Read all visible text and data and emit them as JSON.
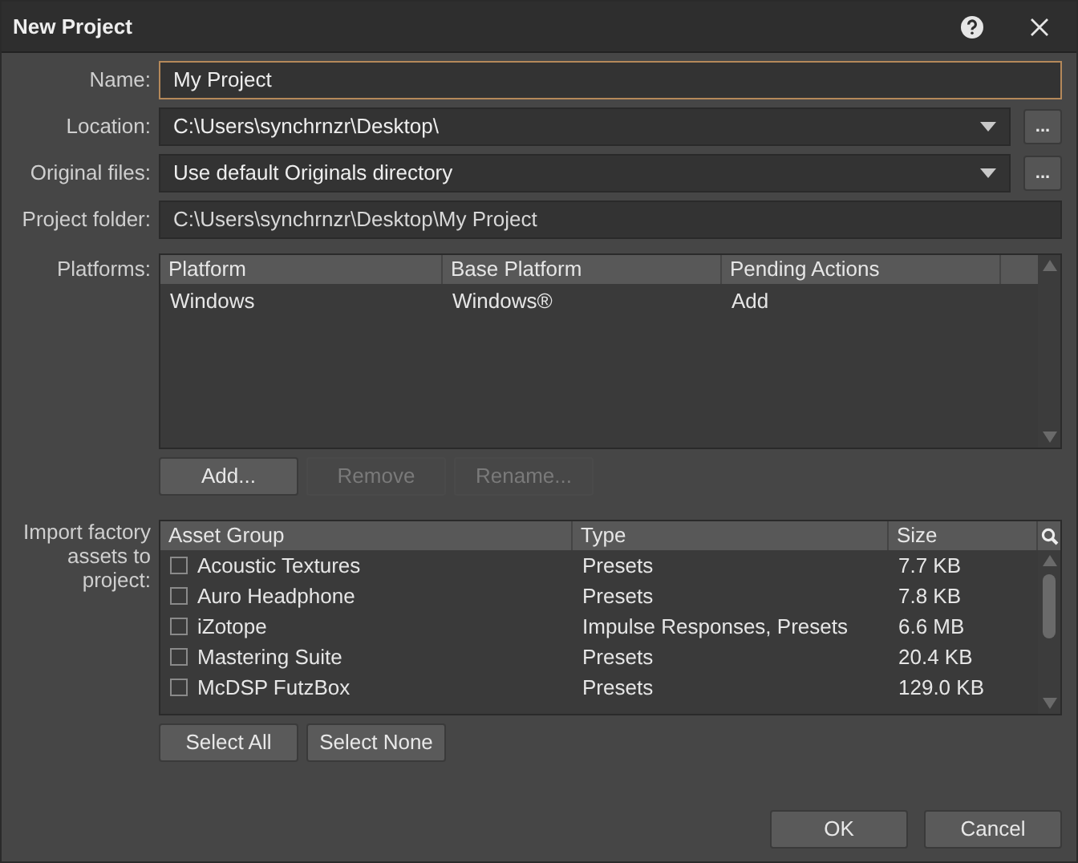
{
  "window": {
    "title": "New Project"
  },
  "fields": [
    {
      "label": "Name:",
      "kind": "text",
      "value": "My Project",
      "focused": true
    },
    {
      "label": "Location:",
      "kind": "combo",
      "value": "C:\\Users\\synchrnzr\\Desktop\\",
      "browse": "..."
    },
    {
      "label": "Original files:",
      "kind": "combo",
      "value": "Use default Originals directory",
      "browse": "..."
    },
    {
      "label": "Project folder:",
      "kind": "readonly",
      "value": "C:\\Users\\synchrnzr\\Desktop\\My Project"
    }
  ],
  "platforms": {
    "label": "Platforms:",
    "columns": [
      "Platform",
      "Base Platform",
      "Pending Actions"
    ],
    "rows": [
      {
        "cells": [
          "Windows",
          "Windows®",
          "Add"
        ]
      }
    ],
    "buttons": [
      {
        "label": "Add...",
        "disabled": false
      },
      {
        "label": "Remove",
        "disabled": true
      },
      {
        "label": "Rename...",
        "disabled": true
      }
    ]
  },
  "assets": {
    "label": "Import factory assets to project:",
    "columns": [
      "Asset Group",
      "Type",
      "Size"
    ],
    "rows": [
      {
        "name": "Acoustic Textures",
        "type": "Presets",
        "size": "7.7 KB",
        "checked": false
      },
      {
        "name": "Auro Headphone",
        "type": "Presets",
        "size": "7.8 KB",
        "checked": false
      },
      {
        "name": "iZotope",
        "type": "Impulse Responses, Presets",
        "size": "6.6 MB",
        "checked": false
      },
      {
        "name": "Mastering Suite",
        "type": "Presets",
        "size": "20.4 KB",
        "checked": false
      },
      {
        "name": "McDSP FutzBox",
        "type": "Presets",
        "size": "129.0 KB",
        "checked": false
      }
    ],
    "buttons": [
      {
        "label": "Select All",
        "disabled": false
      },
      {
        "label": "Select None",
        "disabled": false
      }
    ]
  },
  "footer_buttons": [
    {
      "label": "OK",
      "disabled": false
    },
    {
      "label": "Cancel",
      "disabled": false
    }
  ]
}
